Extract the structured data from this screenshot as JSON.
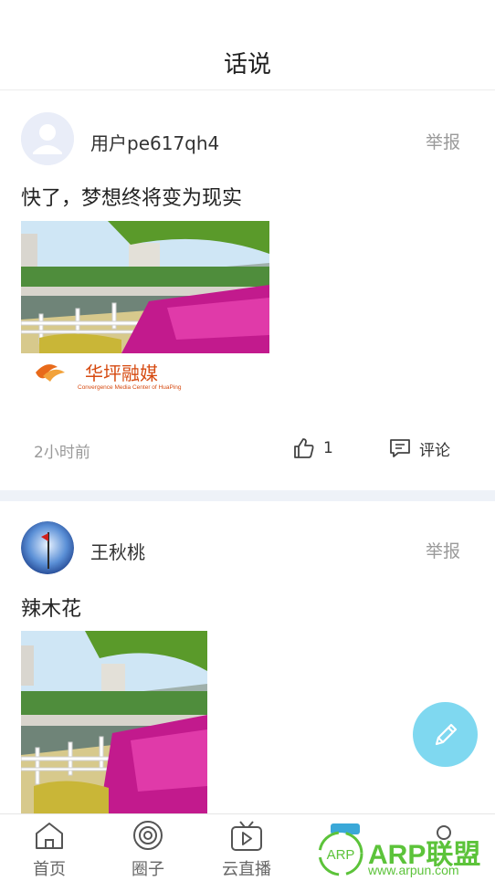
{
  "header": {
    "title": "话说"
  },
  "posts": [
    {
      "username": "用户pe617qh4",
      "report_label": "举报",
      "text": "快了，梦想终将变为现实",
      "image_caption_cn": "华坪融媒",
      "image_caption_en": "Convergence Media Center of HuaPing",
      "time": "2小时前",
      "likes": "1",
      "comment_label": "评论"
    },
    {
      "username": "王秋桃",
      "report_label": "举报",
      "text": "辣木花"
    }
  ],
  "tabbar": {
    "items": [
      {
        "label": "首页",
        "icon": "home-icon"
      },
      {
        "label": "圈子",
        "icon": "circle-icon"
      },
      {
        "label": "云直播",
        "icon": "tv-play-icon"
      },
      {
        "label": "",
        "icon": "chat-icon"
      },
      {
        "label": "",
        "icon": "user-icon"
      }
    ]
  },
  "watermark": {
    "text": "ARP联盟",
    "url": "www.arpun.com",
    "badge": "ARP"
  },
  "colors": {
    "fab": "#7fd8f0",
    "divider": "#eef2f8",
    "watermark": "#5cc33a"
  }
}
